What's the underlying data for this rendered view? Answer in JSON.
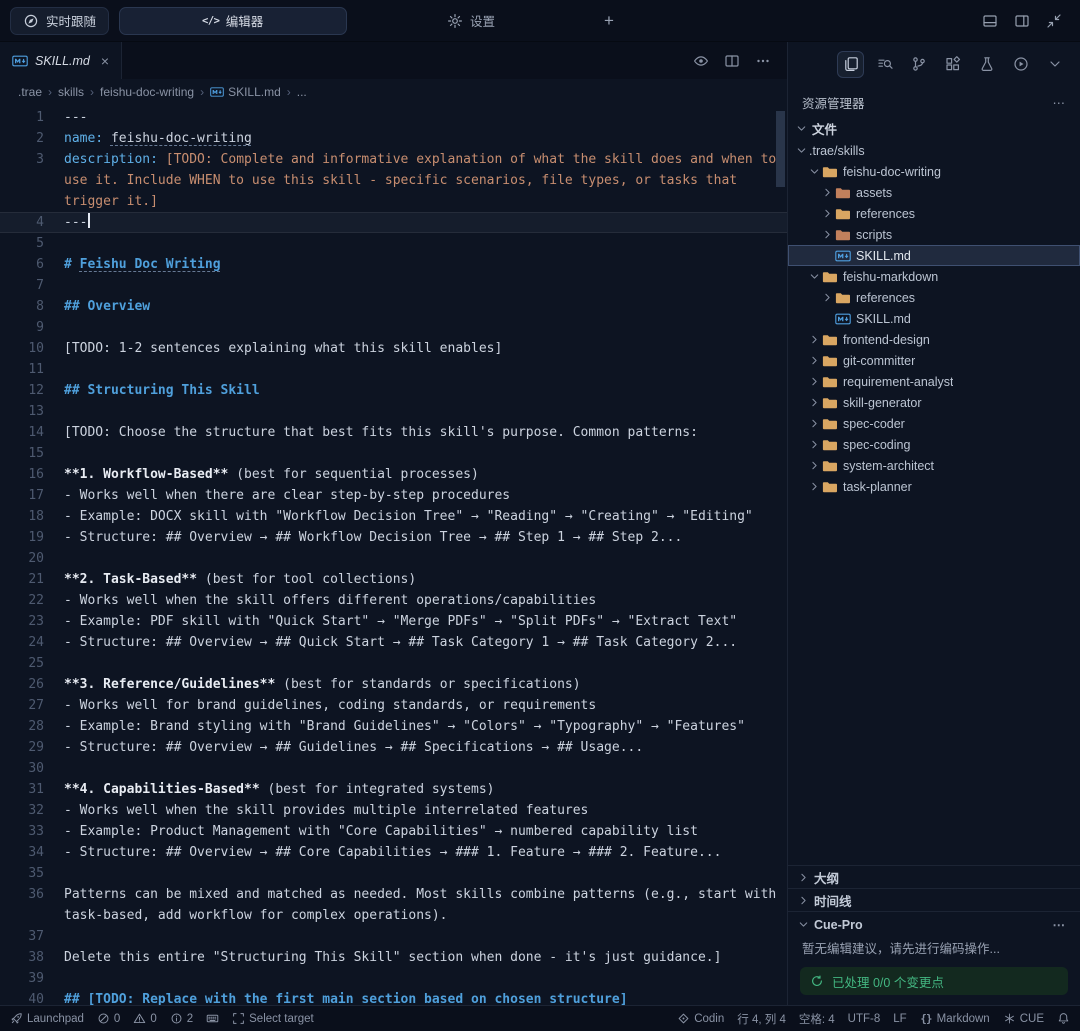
{
  "colors": {
    "heading_blue": "#4fa0dc",
    "key_blue": "#5fb0e8",
    "string_orange": "#c88e70",
    "folder_yellow": "#d9a662",
    "markdown_blue": "#4f9fe0",
    "success_green": "#43b681"
  },
  "topbar": {
    "follow_tab": {
      "label": "实时跟随",
      "icon": "follow-icon"
    },
    "editor_tab": {
      "label": "编辑器",
      "icon": "code-icon"
    },
    "settings_tab": {
      "label": "设置",
      "icon": "gear-icon"
    },
    "add_label": "+",
    "right_icons": [
      "panel-bottom-icon",
      "panel-right-icon",
      "collapse-icon"
    ]
  },
  "editor": {
    "tab": {
      "title": "SKILL.md",
      "close": "×",
      "icon": "markdown-icon"
    },
    "actions": [
      "preview-icon",
      "split-editor-icon",
      "more-actions-icon"
    ],
    "breadcrumb_separator": "›",
    "breadcrumb": [
      {
        "label": ".trae"
      },
      {
        "label": "skills"
      },
      {
        "label": "feishu-doc-writing"
      },
      {
        "label": "SKILL.md",
        "icon": "markdown-icon"
      },
      {
        "label": "..."
      }
    ],
    "lines": [
      {
        "n": 1,
        "seg": [
          [
            "---",
            "p"
          ]
        ]
      },
      {
        "n": 2,
        "seg": [
          [
            "name: ",
            "key"
          ],
          [
            "feishu-doc-writing",
            "link"
          ]
        ]
      },
      {
        "n": 3,
        "seg": [
          [
            "description: ",
            "key"
          ],
          [
            "[TODO: Complete and informative explanation of what the skill does and when to use it. Include WHEN to use this skill - specific scenarios, file types, or tasks that trigger it.]",
            "str"
          ]
        ]
      },
      {
        "n": 4,
        "seg": [
          [
            "---",
            "p"
          ]
        ],
        "cursor": true,
        "current": true
      },
      {
        "n": 5,
        "seg": []
      },
      {
        "n": 6,
        "seg": [
          [
            "# ",
            "h"
          ],
          [
            "Feishu Doc Writing",
            "hl"
          ]
        ]
      },
      {
        "n": 7,
        "seg": []
      },
      {
        "n": 8,
        "seg": [
          [
            "## Overview",
            "h"
          ]
        ]
      },
      {
        "n": 9,
        "seg": []
      },
      {
        "n": 10,
        "seg": [
          [
            "[TODO: 1-2 sentences explaining what this skill enables]",
            "p"
          ]
        ]
      },
      {
        "n": 11,
        "seg": []
      },
      {
        "n": 12,
        "seg": [
          [
            "## Structuring This Skill",
            "h"
          ]
        ]
      },
      {
        "n": 13,
        "seg": []
      },
      {
        "n": 14,
        "seg": [
          [
            "[TODO: Choose the structure that best fits this skill's purpose. Common patterns:",
            "p"
          ]
        ]
      },
      {
        "n": 15,
        "seg": []
      },
      {
        "n": 16,
        "seg": [
          [
            "**1. Workflow-Based**",
            "b"
          ],
          [
            " (best for sequential processes)",
            "p"
          ]
        ]
      },
      {
        "n": 17,
        "seg": [
          [
            "- Works well when there are clear step-by-step procedures",
            "p"
          ]
        ]
      },
      {
        "n": 18,
        "seg": [
          [
            "- Example: DOCX skill with \"Workflow Decision Tree\" → \"Reading\" → \"Creating\" → \"Editing\"",
            "p"
          ]
        ]
      },
      {
        "n": 19,
        "seg": [
          [
            "- Structure: ## Overview → ## Workflow Decision Tree → ## Step 1 → ## Step 2...",
            "p"
          ]
        ]
      },
      {
        "n": 20,
        "seg": []
      },
      {
        "n": 21,
        "seg": [
          [
            "**2. Task-Based**",
            "b"
          ],
          [
            " (best for tool collections)",
            "p"
          ]
        ]
      },
      {
        "n": 22,
        "seg": [
          [
            "- Works well when the skill offers different operations/capabilities",
            "p"
          ]
        ]
      },
      {
        "n": 23,
        "seg": [
          [
            "- Example: PDF skill with \"Quick Start\" → \"Merge PDFs\" → \"Split PDFs\" → \"Extract Text\"",
            "p"
          ]
        ]
      },
      {
        "n": 24,
        "seg": [
          [
            "- Structure: ## Overview → ## Quick Start → ## Task Category 1 → ## Task Category 2...",
            "p"
          ]
        ]
      },
      {
        "n": 25,
        "seg": []
      },
      {
        "n": 26,
        "seg": [
          [
            "**3. Reference/Guidelines**",
            "b"
          ],
          [
            " (best for standards or specifications)",
            "p"
          ]
        ]
      },
      {
        "n": 27,
        "seg": [
          [
            "- Works well for brand guidelines, coding standards, or requirements",
            "p"
          ]
        ]
      },
      {
        "n": 28,
        "seg": [
          [
            "- Example: Brand styling with \"Brand Guidelines\" → \"Colors\" → \"Typography\" → \"Features\"",
            "p"
          ]
        ]
      },
      {
        "n": 29,
        "seg": [
          [
            "- Structure: ## Overview → ## Guidelines → ## Specifications → ## Usage...",
            "p"
          ]
        ]
      },
      {
        "n": 30,
        "seg": []
      },
      {
        "n": 31,
        "seg": [
          [
            "**4. Capabilities-Based**",
            "b"
          ],
          [
            " (best for integrated systems)",
            "p"
          ]
        ]
      },
      {
        "n": 32,
        "seg": [
          [
            "- Works well when the skill provides multiple interrelated features",
            "p"
          ]
        ]
      },
      {
        "n": 33,
        "seg": [
          [
            "- Example: Product Management with \"Core Capabilities\" → numbered capability list",
            "p"
          ]
        ]
      },
      {
        "n": 34,
        "seg": [
          [
            "- Structure: ## Overview → ## Core Capabilities → ### 1. Feature → ### 2. Feature...",
            "p"
          ]
        ]
      },
      {
        "n": 35,
        "seg": []
      },
      {
        "n": 36,
        "seg": [
          [
            "Patterns can be mixed and matched as needed. Most skills combine patterns (e.g., start with task-based, add workflow for complex operations).",
            "p"
          ]
        ]
      },
      {
        "n": 37,
        "seg": []
      },
      {
        "n": 38,
        "seg": [
          [
            "Delete this entire \"Structuring This Skill\" section when done - it's just guidance.]",
            "p"
          ]
        ]
      },
      {
        "n": 39,
        "seg": []
      },
      {
        "n": 40,
        "seg": [
          [
            "## [TODO: Replace with the first main section based on chosen structure]",
            "h"
          ]
        ]
      }
    ]
  },
  "sidebar": {
    "activity_icons": [
      {
        "name": "files-icon",
        "active": true
      },
      {
        "name": "search-icon",
        "active": false
      },
      {
        "name": "git-branch-icon",
        "active": false
      },
      {
        "name": "extensions-icon",
        "active": false
      },
      {
        "name": "beaker-icon",
        "active": false
      },
      {
        "name": "run-icon",
        "active": false
      },
      {
        "name": "chevron-down-icon",
        "active": false
      }
    ],
    "title": "资源管理器",
    "more_label": "⋯",
    "files_section": "文件",
    "tree": [
      {
        "label": ".trae/skills",
        "level": 0,
        "chevron": "down",
        "icon": ""
      },
      {
        "label": "feishu-doc-writing",
        "level": 1,
        "chevron": "down",
        "icon": "folder-icon"
      },
      {
        "label": "assets",
        "level": 2,
        "chevron": "right",
        "icon": "folder-alt-icon"
      },
      {
        "label": "references",
        "level": 2,
        "chevron": "right",
        "icon": "folder-icon"
      },
      {
        "label": "scripts",
        "level": 2,
        "chevron": "right",
        "icon": "folder-alt-icon"
      },
      {
        "label": "SKILL.md",
        "level": 2,
        "chevron": "",
        "icon": "markdown-icon",
        "selected": true
      },
      {
        "label": "feishu-markdown",
        "level": 1,
        "chevron": "down",
        "icon": "folder-icon"
      },
      {
        "label": "references",
        "level": 2,
        "chevron": "right",
        "icon": "folder-icon"
      },
      {
        "label": "SKILL.md",
        "level": 2,
        "chevron": "",
        "icon": "markdown-icon"
      },
      {
        "label": "frontend-design",
        "level": 1,
        "chevron": "right",
        "icon": "folder-icon"
      },
      {
        "label": "git-committer",
        "level": 1,
        "chevron": "right",
        "icon": "folder-icon"
      },
      {
        "label": "requirement-analyst",
        "level": 1,
        "chevron": "right",
        "icon": "folder-icon"
      },
      {
        "label": "skill-generator",
        "level": 1,
        "chevron": "right",
        "icon": "folder-icon"
      },
      {
        "label": "spec-coder",
        "level": 1,
        "chevron": "right",
        "icon": "folder-icon"
      },
      {
        "label": "spec-coding",
        "level": 1,
        "chevron": "right",
        "icon": "folder-icon"
      },
      {
        "label": "system-architect",
        "level": 1,
        "chevron": "right",
        "icon": "folder-icon"
      },
      {
        "label": "task-planner",
        "level": 1,
        "chevron": "right",
        "icon": "folder-icon"
      }
    ],
    "outline_label": "大纲",
    "timeline_label": "时间线",
    "cuepro": {
      "title": "Cue-Pro",
      "more_label": "⋯",
      "empty_text": "暂无编辑建议，请先进行编码操作...",
      "processed_text": "已处理 0/0 个变更点"
    }
  },
  "statusbar": {
    "left": [
      {
        "name": "launchpad-button",
        "icon": "rocket-icon",
        "label": "Launchpad"
      },
      {
        "name": "errors-count",
        "icon": "error-icon",
        "label": "0"
      },
      {
        "name": "warnings-count",
        "icon": "warning-icon",
        "label": "0"
      },
      {
        "name": "infos-count",
        "icon": "info-icon",
        "label": "2"
      },
      {
        "name": "keyboard-button",
        "icon": "keyboard-icon",
        "label": ""
      },
      {
        "name": "select-target-button",
        "icon": "frame-icon",
        "label": "Select target"
      }
    ],
    "right": [
      {
        "name": "codin-button",
        "icon": "codin-icon",
        "label": "Codin"
      },
      {
        "name": "cursor-position",
        "icon": "",
        "label": "行 4, 列 4"
      },
      {
        "name": "indent-setting",
        "icon": "",
        "label": "空格: 4"
      },
      {
        "name": "encoding",
        "icon": "",
        "label": "UTF-8"
      },
      {
        "name": "eol-setting",
        "icon": "",
        "label": "LF"
      },
      {
        "name": "language-mode",
        "icon": "braces-icon",
        "label": "Markdown"
      },
      {
        "name": "cue-button",
        "icon": "snowflake-icon",
        "label": "CUE"
      },
      {
        "name": "notifications-button",
        "icon": "bell-icon",
        "label": ""
      }
    ]
  }
}
